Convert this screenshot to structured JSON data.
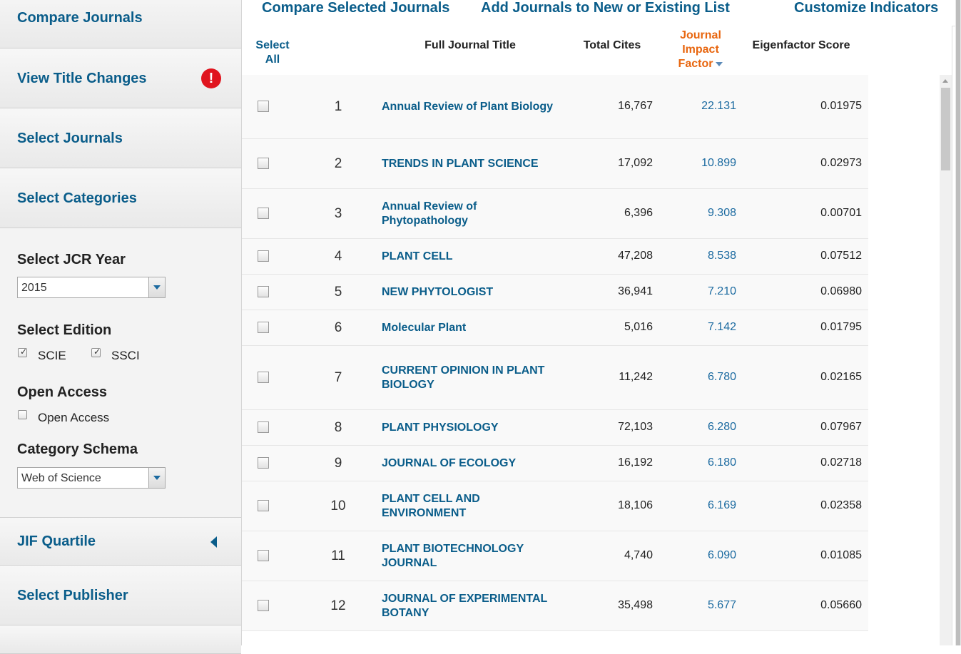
{
  "sidebar": {
    "compare_journals": "Compare Journals",
    "view_title_changes": "View Title Changes",
    "alert_glyph": "!",
    "select_journals": "Select Journals",
    "select_categories": "Select Categories",
    "jif_quartile": "JIF Quartile",
    "select_publisher": "Select Publisher"
  },
  "filters": {
    "jcr_year_heading": "Select JCR Year",
    "jcr_year_value": "2015",
    "edition_heading": "Select Edition",
    "edition_scie": "SCIE",
    "edition_ssci": "SSCI",
    "open_access_heading": "Open Access",
    "open_access_label": "Open Access",
    "category_schema_heading": "Category Schema",
    "category_schema_value": "Web of Science"
  },
  "topbar": {
    "compare_selected": "Compare Selected Journals",
    "add_to_list": "Add Journals to New or Existing List",
    "customize": "Customize Indicators"
  },
  "table": {
    "headers": {
      "select_all_1": "Select",
      "select_all_2": "All",
      "title": "Full Journal Title",
      "cites": "Total Cites",
      "jif_1": "Journal",
      "jif_2": "Impact",
      "jif_3": "Factor",
      "eigenfactor": "Eigenfactor Score"
    },
    "rows": [
      {
        "rank": "1",
        "l1": "Annual Review of Plant Biology",
        "l2": "",
        "cites": "16,767",
        "jif": "22.131",
        "eig": "0.01975"
      },
      {
        "rank": "2",
        "l1": "TRENDS IN PLANT SCIENCE",
        "l2": "",
        "cites": "17,092",
        "jif": "10.899",
        "eig": "0.02973"
      },
      {
        "rank": "3",
        "l1": "Annual Review of",
        "l2": "Phytopathology",
        "cites": "6,396",
        "jif": "9.308",
        "eig": "0.00701"
      },
      {
        "rank": "4",
        "l1": "PLANT CELL",
        "l2": "",
        "cites": "47,208",
        "jif": "8.538",
        "eig": "0.07512"
      },
      {
        "rank": "5",
        "l1": "NEW PHYTOLOGIST",
        "l2": "",
        "cites": "36,941",
        "jif": "7.210",
        "eig": "0.06980"
      },
      {
        "rank": "6",
        "l1": "Molecular Plant",
        "l2": "",
        "cites": "5,016",
        "jif": "7.142",
        "eig": "0.01795"
      },
      {
        "rank": "7",
        "l1": "CURRENT OPINION IN PLANT",
        "l2": "BIOLOGY",
        "cites": "11,242",
        "jif": "6.780",
        "eig": "0.02165"
      },
      {
        "rank": "8",
        "l1": "PLANT PHYSIOLOGY",
        "l2": "",
        "cites": "72,103",
        "jif": "6.280",
        "eig": "0.07967"
      },
      {
        "rank": "9",
        "l1": "JOURNAL OF ECOLOGY",
        "l2": "",
        "cites": "16,192",
        "jif": "6.180",
        "eig": "0.02718"
      },
      {
        "rank": "10",
        "l1": "PLANT CELL AND",
        "l2": "ENVIRONMENT",
        "cites": "18,106",
        "jif": "6.169",
        "eig": "0.02358"
      },
      {
        "rank": "11",
        "l1": "PLANT BIOTECHNOLOGY",
        "l2": "JOURNAL",
        "cites": "4,740",
        "jif": "6.090",
        "eig": "0.01085"
      },
      {
        "rank": "12",
        "l1": "JOURNAL OF EXPERIMENTAL",
        "l2": "BOTANY",
        "cites": "35,498",
        "jif": "5.677",
        "eig": "0.05660"
      }
    ]
  }
}
